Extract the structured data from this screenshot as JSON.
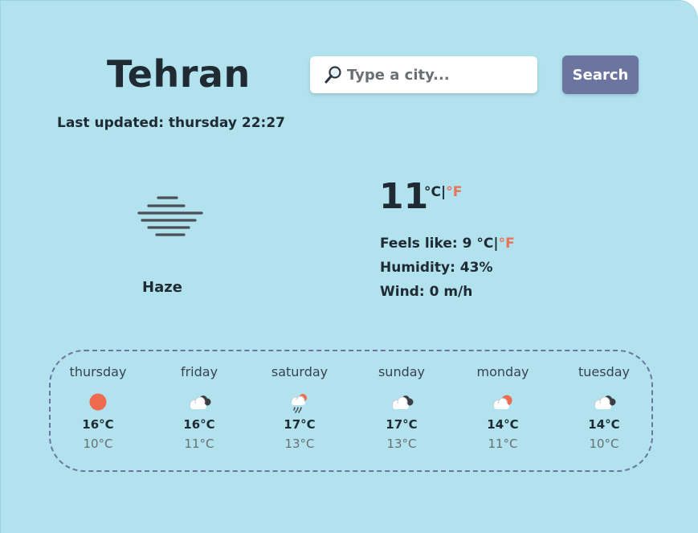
{
  "city": "Tehran",
  "last_updated": "Last updated: thursday 22:27",
  "search": {
    "placeholder": "Type a city...",
    "button_label": "Search"
  },
  "current": {
    "temperature": "11",
    "unit_c": "°C",
    "unit_sep": "|",
    "unit_f": "°F",
    "description": "Haze",
    "icon": "haze-icon",
    "feels_like_label": "Feels like: 9 ",
    "humidity": "Humidity: 43%",
    "wind": "Wind: 0 m/h"
  },
  "colors": {
    "background": "#b1e2ee",
    "accent": "#6c75a0",
    "fahrenheit": "#e8735a",
    "text": "#1f2a33"
  },
  "forecast": [
    {
      "day": "thursday",
      "icon": "sun-icon",
      "high": "16°C",
      "low": "10°C"
    },
    {
      "day": "friday",
      "icon": "cloudy-icon",
      "high": "16°C",
      "low": "11°C"
    },
    {
      "day": "saturday",
      "icon": "rain-sun-icon",
      "high": "17°C",
      "low": "13°C"
    },
    {
      "day": "sunday",
      "icon": "cloudy-icon",
      "high": "17°C",
      "low": "13°C"
    },
    {
      "day": "monday",
      "icon": "partly-cloudy-icon",
      "high": "14°C",
      "low": "11°C"
    },
    {
      "day": "tuesday",
      "icon": "cloudy-icon",
      "high": "14°C",
      "low": "10°C"
    }
  ]
}
